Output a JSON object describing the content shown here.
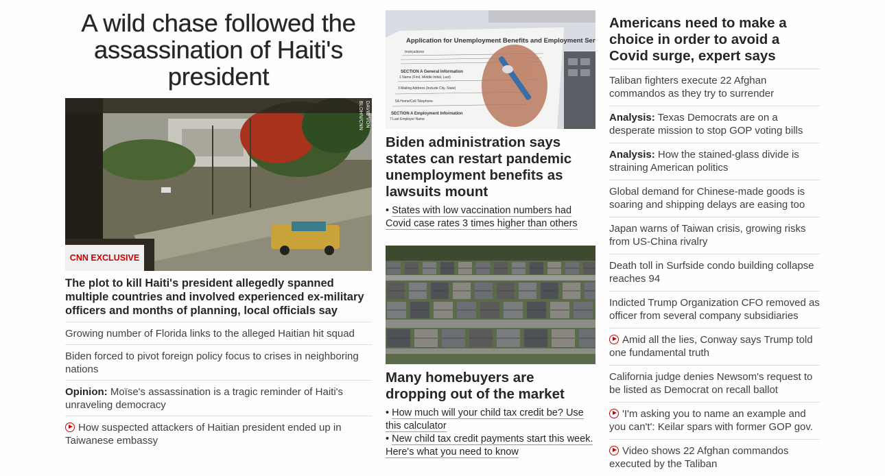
{
  "left": {
    "headline": "A wild chase followed the assassination of Haiti's president",
    "image_credit": "DAVID VON BLOHN/CNN",
    "badge": "CNN EXCLUSIVE",
    "lead": "The plot to kill Haiti's president allegedly spanned multiple countries and involved experienced ex-military officers and months of planning, local officials say",
    "items": [
      {
        "prefix": "",
        "text": "Growing number of Florida links to the alleged Haitian hit squad",
        "video": false
      },
      {
        "prefix": "",
        "text": "Biden forced to pivot foreign policy focus to crises in neighboring nations",
        "video": false
      },
      {
        "prefix": "Opinion:",
        "text": " Moïse's assassination is a tragic reminder of Haiti's unraveling democracy",
        "video": false
      },
      {
        "prefix": "",
        "text": "How suspected attackers of Haitian president ended up in Taiwanese embassy",
        "video": true
      }
    ]
  },
  "middle": {
    "image1_form_title": "Application for Unemployment Benefits and Employment Services",
    "image1_form_sections": [
      "Instructions",
      "SECTION A General Information",
      "1 Name (First, Middle Initial, Last)",
      "3 Mailing Address (Include City, State)",
      "5A Home/Cell Telephone",
      "SECTION A Employment Information",
      "7 Last Employer Name"
    ],
    "story1": {
      "headline": "Biden administration says states can restart pandemic unemployment benefits as lawsuits mount",
      "subs": [
        "States with low vaccination numbers had Covid case rates 3 times higher than others"
      ]
    },
    "story2": {
      "headline": "Many homebuyers are dropping out of the market",
      "subs": [
        "How much will your child tax credit be? Use this calculator",
        "New child tax credit payments start this week. Here's what you need to know"
      ]
    }
  },
  "right": {
    "headline": "Americans need to make a choice in order to avoid a Covid surge, expert says",
    "items": [
      {
        "prefix": "",
        "text": "Taliban fighters execute 22 Afghan commandos as they try to surrender",
        "video": false
      },
      {
        "prefix": "Analysis:",
        "text": " Texas Democrats are on a desperate mission to stop GOP voting bills",
        "video": false
      },
      {
        "prefix": "Analysis:",
        "text": " How the stained-glass divide is straining American politics",
        "video": false
      },
      {
        "prefix": "",
        "text": "Global demand for Chinese-made goods is soaring and shipping delays are easing too",
        "video": false
      },
      {
        "prefix": "",
        "text": "Japan warns of Taiwan crisis, growing risks from US-China rivalry",
        "video": false
      },
      {
        "prefix": "",
        "text": "Death toll in Surfside condo building collapse reaches 94",
        "video": false
      },
      {
        "prefix": "",
        "text": "Indicted Trump Organization CFO removed as officer from several company subsidiaries",
        "video": false
      },
      {
        "prefix": "",
        "text": "Amid all the lies, Conway says Trump told one fundamental truth",
        "video": true
      },
      {
        "prefix": "",
        "text": "California judge denies Newsom's request to be listed as Democrat on recall ballot",
        "video": false
      },
      {
        "prefix": "",
        "text": "'I'm asking you to name an example and you can't': Keilar spars with former GOP gov.",
        "video": true
      },
      {
        "prefix": "",
        "text": "Video shows 22 Afghan commandos executed by the Taliban",
        "video": true
      }
    ]
  },
  "colors": {
    "accent": "#cc0000",
    "text": "#262626",
    "divider": "#dedede"
  }
}
